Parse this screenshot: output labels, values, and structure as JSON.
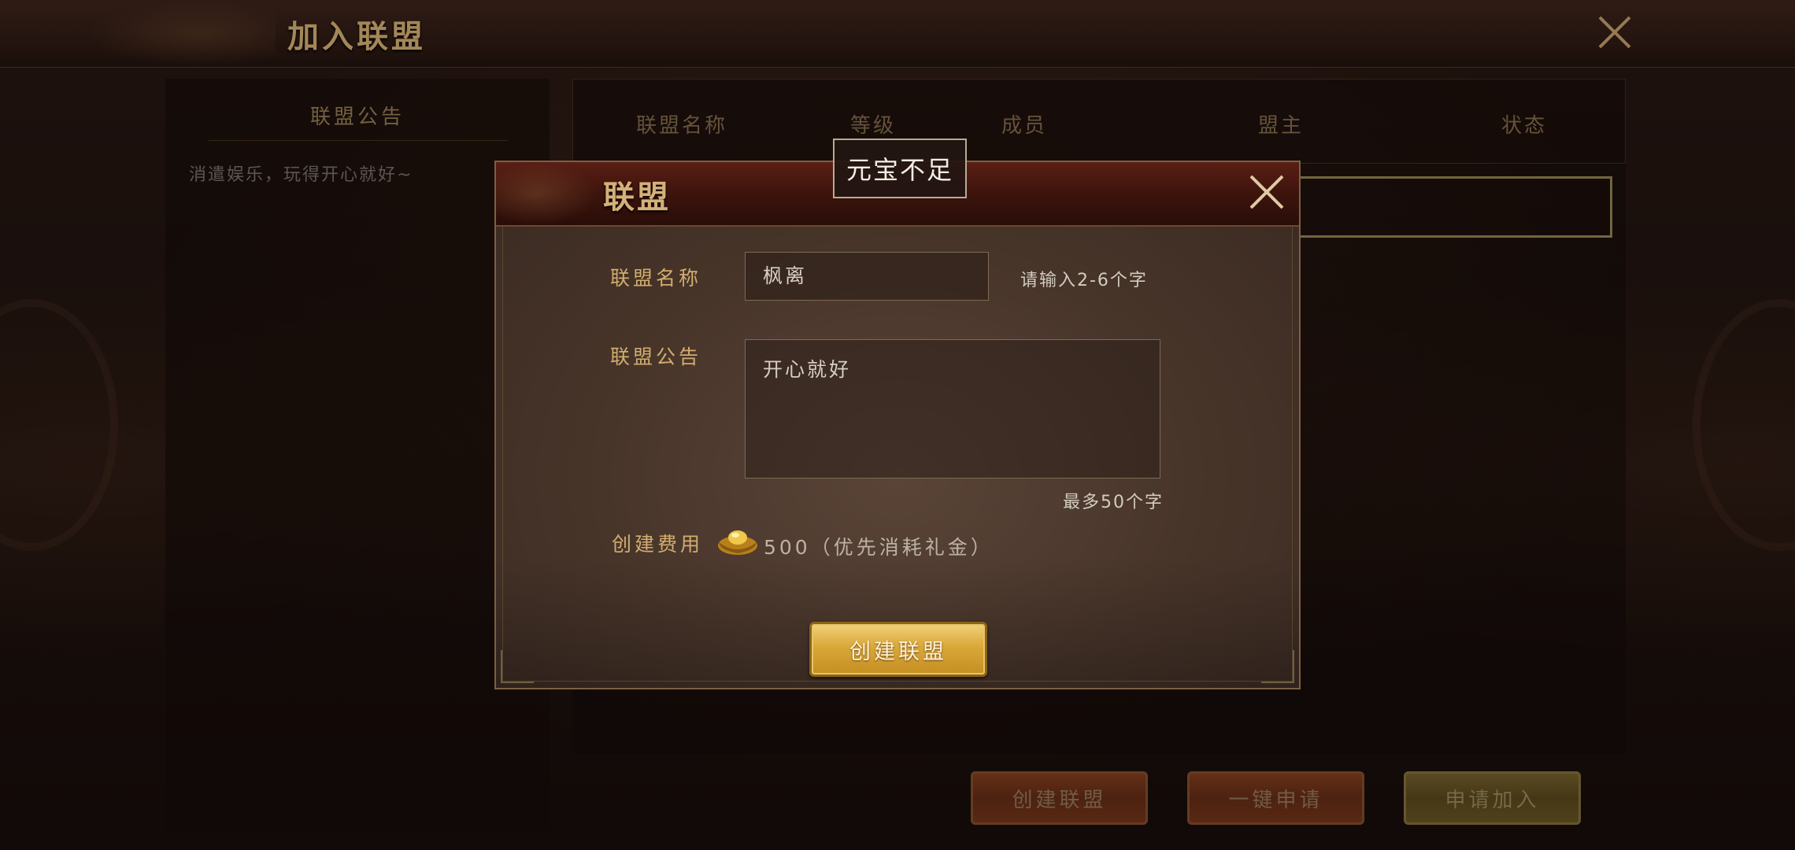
{
  "header": {
    "title": "加入联盟"
  },
  "left_panel": {
    "title": "联盟公告",
    "notice": "消遣娱乐，玩得开心就好~"
  },
  "table": {
    "columns": [
      "联盟名称",
      "等级",
      "成员",
      "盟主",
      "状态"
    ]
  },
  "bottom_buttons": {
    "create": "创建联盟",
    "quick_apply": "一键申请",
    "apply": "申请加入"
  },
  "modal": {
    "title": "联盟",
    "name_label": "联盟名称",
    "name_value": "枫离",
    "name_hint": "请输入2-6个字",
    "notice_label": "联盟公告",
    "notice_value": "开心就好",
    "notice_hint": "最多50个字",
    "cost_label": "创建费用",
    "cost_value": "500（优先消耗礼金）",
    "cost_icon": "gold-ingot-icon",
    "create_button": "创建联盟"
  },
  "toast": {
    "text": "元宝不足"
  },
  "colors": {
    "gold_text": "#d1ad6f",
    "button_gold": "#d9a838",
    "header_red": "#5a1e14"
  }
}
